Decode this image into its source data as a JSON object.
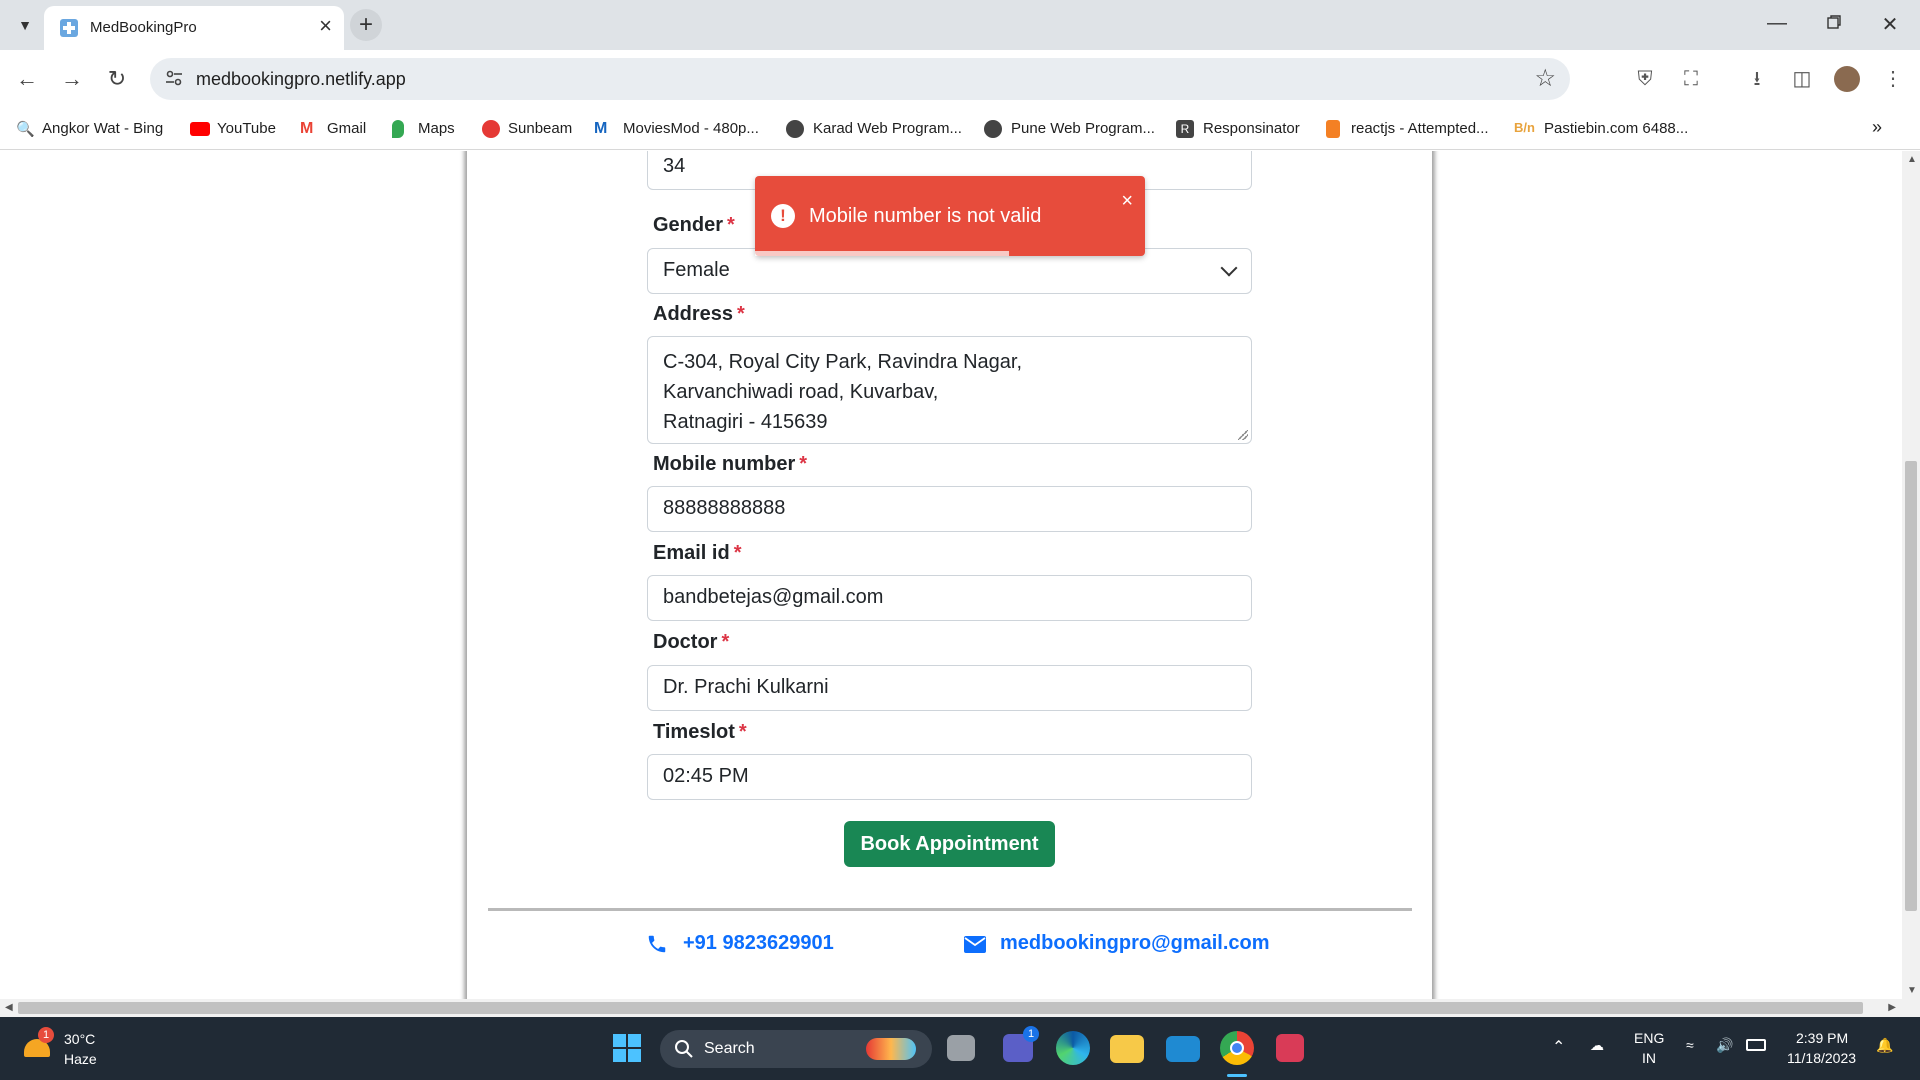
{
  "browser": {
    "tab_title": "MedBookingPro",
    "url": "medbookingpro.netlify.app"
  },
  "bookmarks": [
    {
      "label": "Angkor Wat - Bing",
      "icon": "search-icon"
    },
    {
      "label": "YouTube",
      "icon": "youtube-icon"
    },
    {
      "label": "Gmail",
      "icon": "gmail-icon"
    },
    {
      "label": "Maps",
      "icon": "maps-icon"
    },
    {
      "label": "Sunbeam",
      "icon": "sunbeam-icon"
    },
    {
      "label": "MoviesMod - 480p...",
      "icon": "moviesmod-icon"
    },
    {
      "label": "Karad Web Program...",
      "icon": "globe-icon"
    },
    {
      "label": "Pune Web Program...",
      "icon": "globe-icon"
    },
    {
      "label": "Responsinator",
      "icon": "responsinator-icon"
    },
    {
      "label": "reactjs - Attempted...",
      "icon": "stackoverflow-icon"
    },
    {
      "label": "Pastiebin.com 6488...",
      "icon": "pastebin-icon"
    }
  ],
  "form": {
    "age_value": "34",
    "gender": {
      "label": "Gender",
      "value": "Female"
    },
    "address": {
      "label": "Address",
      "lines": [
        "C-304, Royal City Park, Ravindra Nagar,",
        "Karvanchiwadi road, Kuvarbav,",
        "Ratnagiri - 415639"
      ]
    },
    "mobile": {
      "label": "Mobile number",
      "value": "88888888888"
    },
    "email": {
      "label": "Email id",
      "value": "bandbetejas@gmail.com"
    },
    "doctor": {
      "label": "Doctor",
      "value": "Dr. Prachi Kulkarni"
    },
    "timeslot": {
      "label": "Timeslot",
      "value": "02:45 PM"
    },
    "required_marker": "*",
    "submit_label": "Book Appointment"
  },
  "toast": {
    "message": "Mobile number is not valid",
    "close": "×",
    "progress_fraction": 0.65,
    "color": "#e74c3c"
  },
  "footer": {
    "phone": "+91 9823629901",
    "email": "medbookingpro@gmail.com"
  },
  "taskbar": {
    "temperature": "30°C",
    "condition": "Haze",
    "weather_badge": "1",
    "search_label": "Search",
    "teams_badge": "1",
    "language": "ENG",
    "region": "IN",
    "time": "2:39 PM",
    "date": "11/18/2023"
  },
  "colors": {
    "accent_button": "#198754",
    "link": "#0d6efd",
    "required": "#dc3545"
  }
}
